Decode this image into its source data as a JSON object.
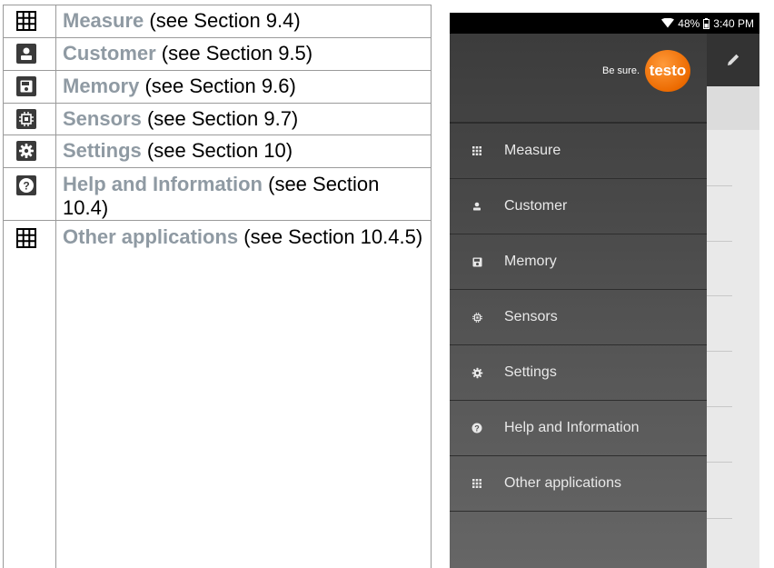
{
  "reference_rows": [
    {
      "icon": "grid-icon",
      "keyword": "Measure",
      "text": " (see Section 9.4)"
    },
    {
      "icon": "person-icon",
      "keyword": "Customer",
      "text": " (see Section 9.5)"
    },
    {
      "icon": "save-icon",
      "keyword": "Memory",
      "text": " (see Section 9.6)"
    },
    {
      "icon": "chip-icon",
      "keyword": "Sensors",
      "text": " (see Section 9.7)"
    },
    {
      "icon": "gear-icon",
      "keyword": "Settings",
      "text": " (see Section 10)"
    },
    {
      "icon": "help-icon",
      "keyword": "Help and Information",
      "text": " (see Section 10.4)"
    },
    {
      "icon": "grid-icon",
      "keyword": "Other applications",
      "text": " (see Section 10.4.5)"
    }
  ],
  "device": {
    "status": {
      "battery": "48%",
      "time": "3:40 PM"
    },
    "brand": {
      "tagline": "Be sure.",
      "logo_text": "testo"
    },
    "menu": [
      {
        "icon": "grid-icon",
        "label": "Measure"
      },
      {
        "icon": "person-icon",
        "label": "Customer"
      },
      {
        "icon": "save-icon",
        "label": "Memory"
      },
      {
        "icon": "chip-icon",
        "label": "Sensors"
      },
      {
        "icon": "gear-icon",
        "label": "Settings"
      },
      {
        "icon": "help-icon",
        "label": "Help and Information"
      },
      {
        "icon": "grid-icon",
        "label": "Other applications"
      }
    ]
  },
  "colors": {
    "keyword": "#8f9aa3",
    "brand_orange": "#ec6a00",
    "drawer": "#3c3c3c"
  }
}
